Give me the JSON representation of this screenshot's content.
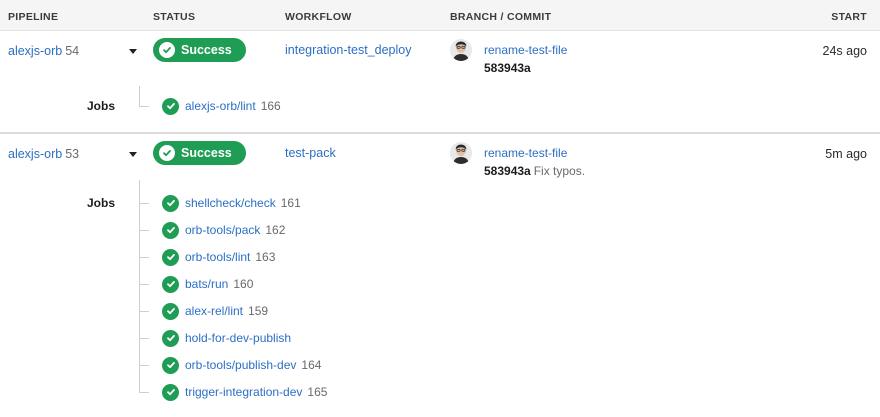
{
  "columns": {
    "pipeline": "PIPELINE",
    "status": "STATUS",
    "workflow": "WORKFLOW",
    "branch_commit": "BRANCH / COMMIT",
    "start": "START"
  },
  "jobs_label": "Jobs",
  "colors": {
    "success": "#1f9d55",
    "link": "#2b6fc4"
  },
  "icons": {
    "status": "check-circle-icon",
    "expand": "caret-down-icon"
  },
  "rows": [
    {
      "pipeline": "alexjs-orb",
      "number": "54",
      "status": "Success",
      "workflow": "integration-test_deploy",
      "branch": "rename-test-file",
      "commit_sha": "583943a",
      "commit_message": "",
      "start": "24s ago",
      "jobs": [
        {
          "name": "alexjs-orb/lint",
          "number": "166"
        }
      ]
    },
    {
      "pipeline": "alexjs-orb",
      "number": "53",
      "status": "Success",
      "workflow": "test-pack",
      "branch": "rename-test-file",
      "commit_sha": "583943a",
      "commit_message": "Fix typos.",
      "start": "5m ago",
      "jobs": [
        {
          "name": "shellcheck/check",
          "number": "161"
        },
        {
          "name": "orb-tools/pack",
          "number": "162"
        },
        {
          "name": "orb-tools/lint",
          "number": "163"
        },
        {
          "name": "bats/run",
          "number": "160"
        },
        {
          "name": "alex-rel/lint",
          "number": "159"
        },
        {
          "name": "hold-for-dev-publish",
          "number": ""
        },
        {
          "name": "orb-tools/publish-dev",
          "number": "164"
        },
        {
          "name": "trigger-integration-dev",
          "number": "165"
        }
      ]
    }
  ]
}
